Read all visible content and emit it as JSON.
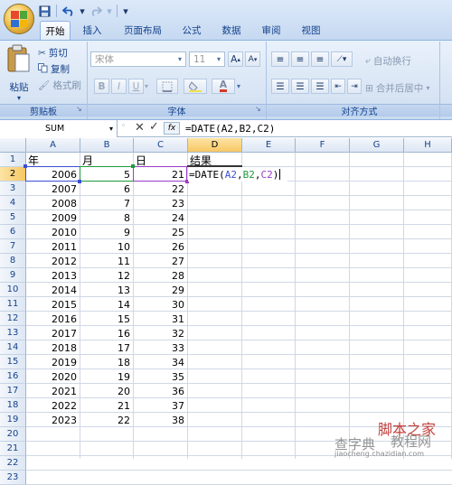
{
  "qat": {
    "save": "save-icon",
    "undo": "undo-icon",
    "redo": "redo-icon"
  },
  "tabs": [
    "开始",
    "插入",
    "页面布局",
    "公式",
    "数据",
    "审阅",
    "视图"
  ],
  "clipboard": {
    "paste": "粘贴",
    "cut": "剪切",
    "copy": "复制",
    "format_painter": "格式刷",
    "label": "剪贴板"
  },
  "font": {
    "name": "宋体",
    "size": "11",
    "grow": "A",
    "shrink": "A",
    "bold": "B",
    "italic": "I",
    "underline": "U",
    "label": "字体",
    "font_color_letter": "A"
  },
  "alignment": {
    "wrap": "自动换行",
    "merge": "合并后居中",
    "label": "对齐方式"
  },
  "formula_bar": {
    "name_box": "SUM",
    "fx": "fx",
    "formula": "=DATE(A2,B2,C2)"
  },
  "columns": [
    "A",
    "B",
    "C",
    "D",
    "E",
    "F",
    "G",
    "H"
  ],
  "rows": [
    "1",
    "2",
    "3",
    "4",
    "5",
    "6",
    "7",
    "8",
    "9",
    "10",
    "11",
    "12",
    "13",
    "14",
    "15",
    "16",
    "17",
    "18",
    "19",
    "20",
    "21",
    "22",
    "23"
  ],
  "headers": {
    "a": "年",
    "b": "月",
    "c": "日",
    "d": "结果"
  },
  "years": [
    "2006",
    "2007",
    "2008",
    "2009",
    "2010",
    "2011",
    "2012",
    "2013",
    "2014",
    "2015",
    "2016",
    "2017",
    "2018",
    "2019",
    "2020",
    "2021",
    "2022",
    "2023"
  ],
  "months": [
    "5",
    "6",
    "7",
    "8",
    "9",
    "10",
    "11",
    "12",
    "13",
    "14",
    "15",
    "16",
    "17",
    "18",
    "19",
    "20",
    "21",
    "22"
  ],
  "days": [
    "21",
    "22",
    "23",
    "24",
    "25",
    "26",
    "27",
    "28",
    "29",
    "30",
    "31",
    "32",
    "33",
    "34",
    "35",
    "36",
    "37",
    "38"
  ],
  "edit_cell": {
    "prefix": "=DATE(",
    "a": "A2",
    "sep1": ",",
    "b": "B2",
    "sep2": ",",
    "c": "C2",
    "suffix": ")"
  },
  "watermark": {
    "line1": "脚本之家",
    "line2": "查字典",
    "line3": "教程网",
    "url": "jiaocheng.chazidian.com"
  },
  "colors": {
    "ref_a": "#3b4fd6",
    "ref_b": "#1f9a3c",
    "ref_c": "#9b3dc7",
    "selection": "#f7c764"
  }
}
